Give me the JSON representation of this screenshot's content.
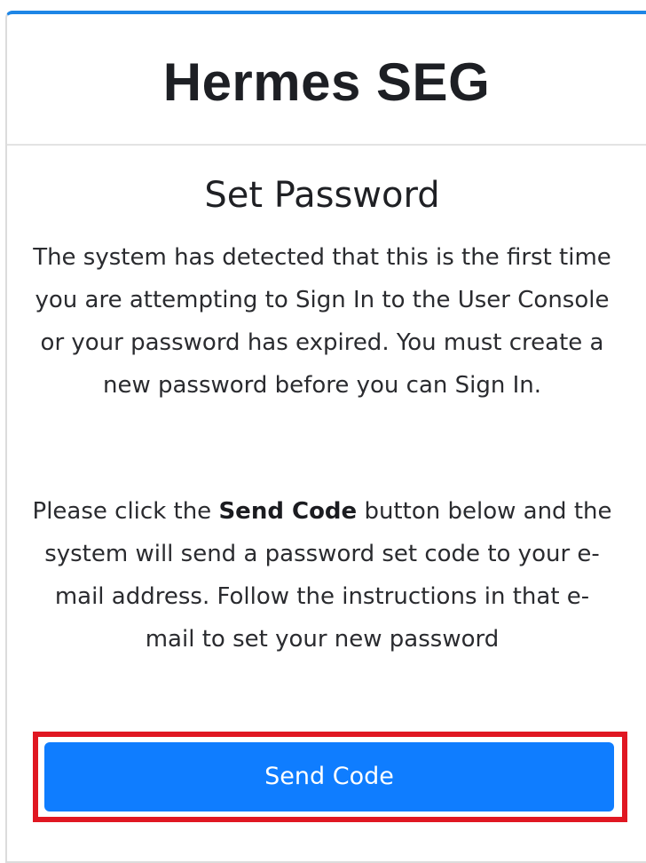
{
  "header": {
    "brand": "Hermes SEG"
  },
  "main": {
    "title": "Set Password",
    "intro": "The system has detected that this is the first time you are attempting to Sign In to the User Console or your password has expired. You must create a new password before you can Sign In.",
    "instructions_before": "Please click the ",
    "instructions_bold": "Send Code",
    "instructions_after": " button below and the system will send a password set code to your e-mail address. Follow the instructions in that e-mail to set your new password",
    "send_button_label": "Send Code"
  },
  "colors": {
    "accent": "#0f7dff",
    "highlight": "#e01722",
    "top_border": "#1e86e6"
  }
}
